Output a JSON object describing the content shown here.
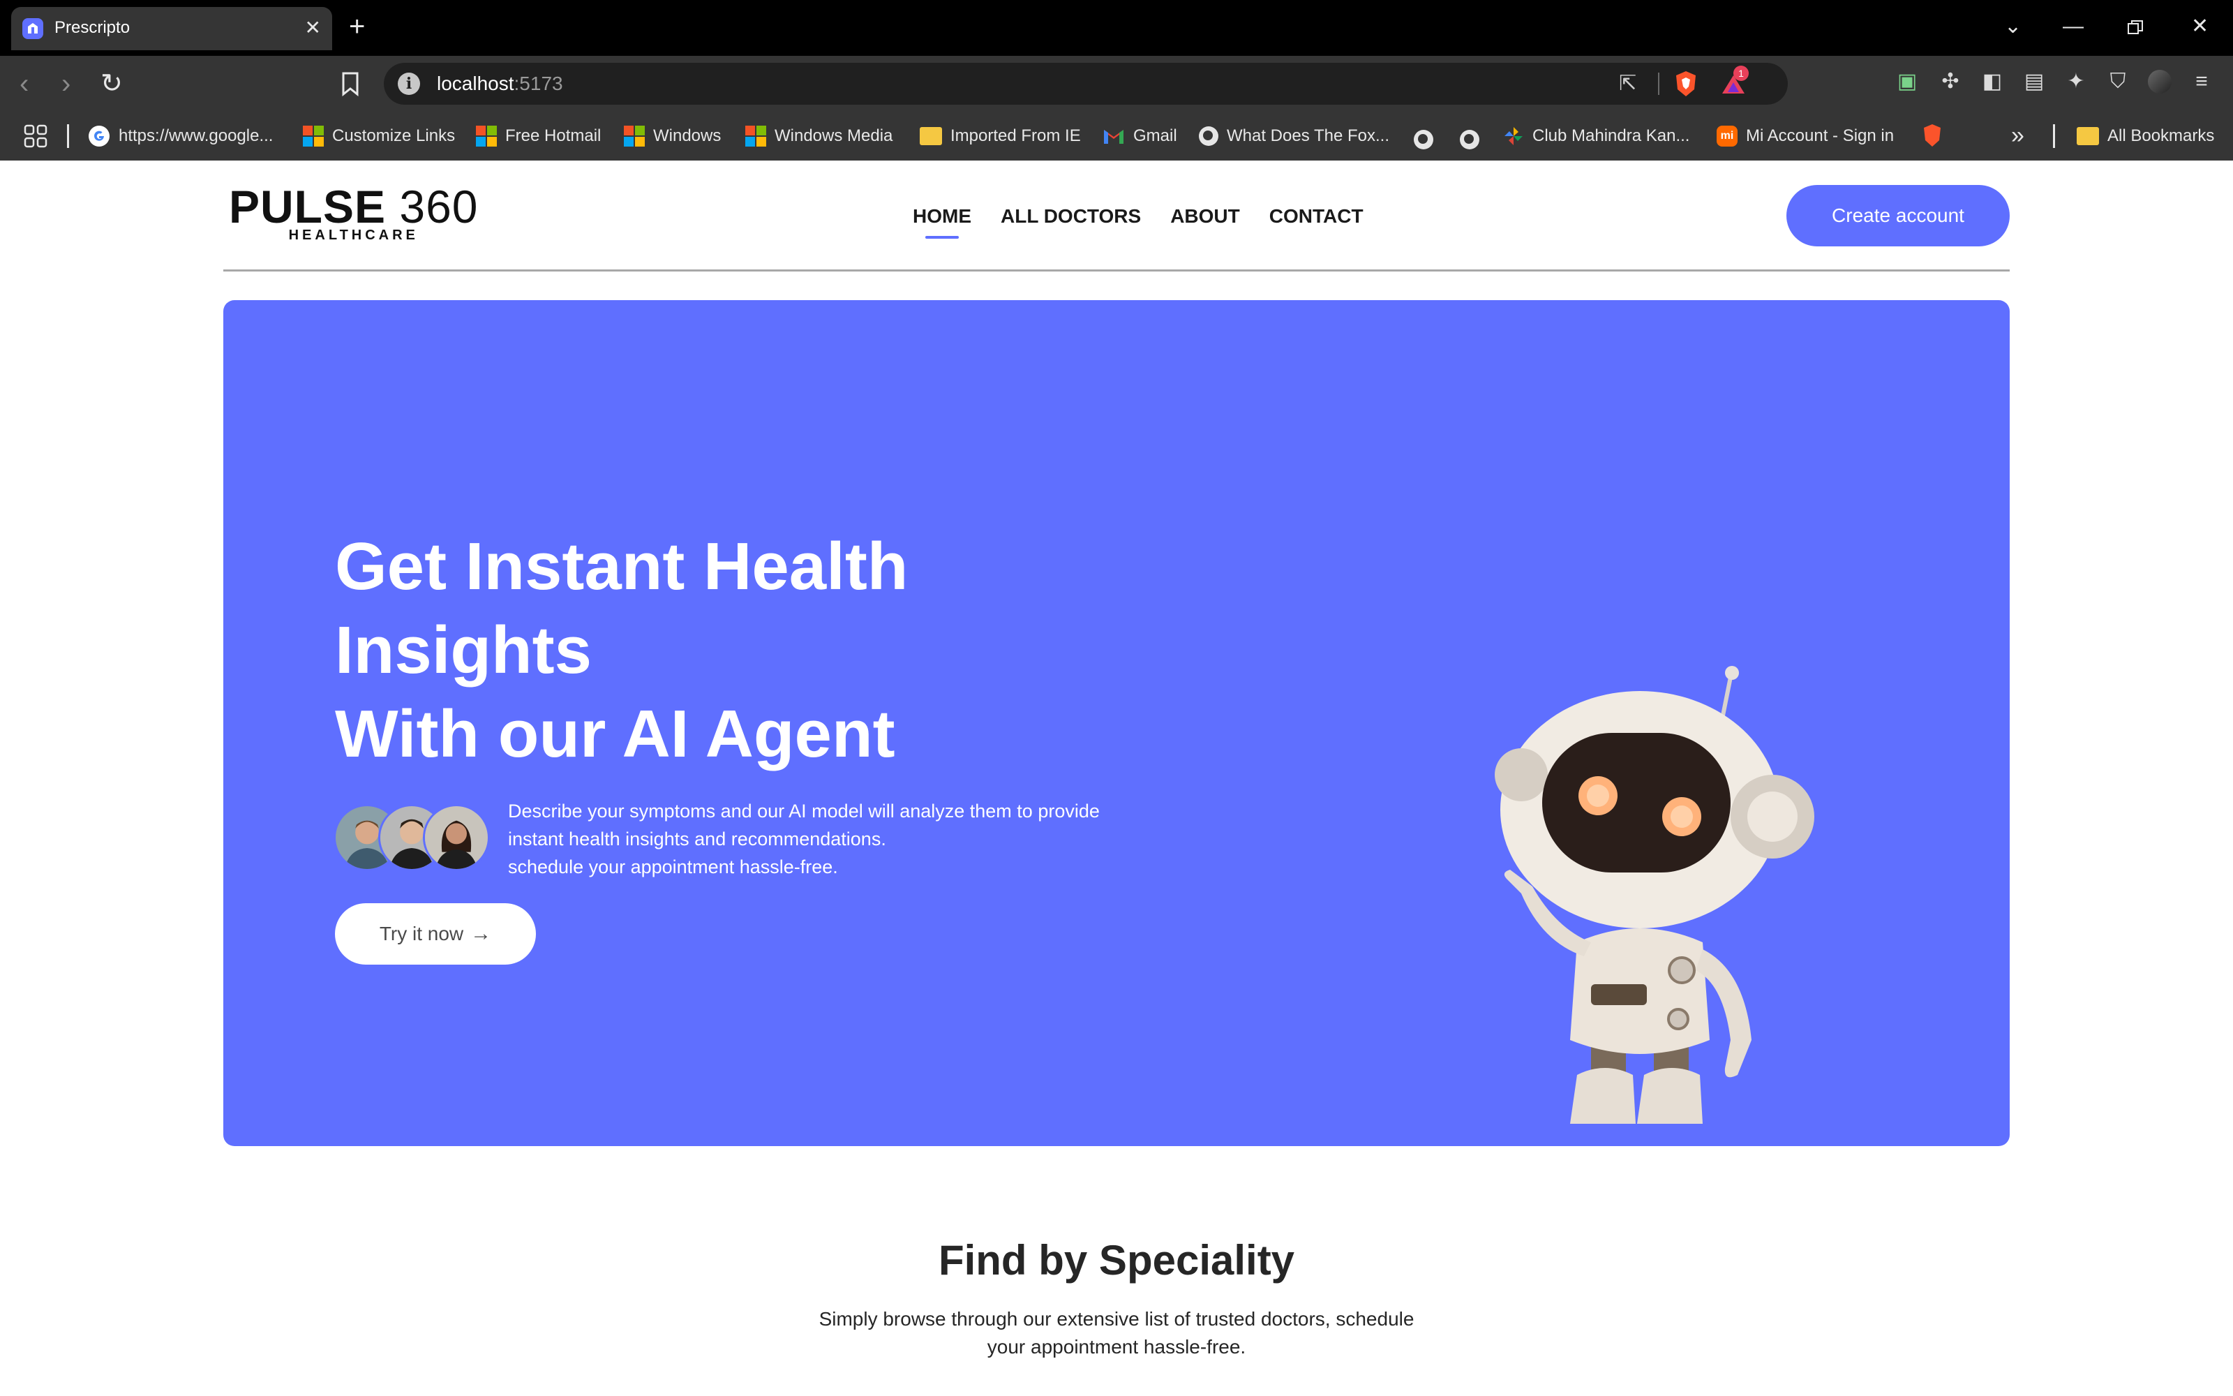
{
  "browser": {
    "tab_title": "Prescripto",
    "url_host": "localhost",
    "url_port": ":5173",
    "shield_badge": "1",
    "bookmarks": [
      {
        "label": "https://www.google...",
        "icon": "google-icon"
      },
      {
        "label": "Customize Links",
        "icon": "windows-icon"
      },
      {
        "label": "Free Hotmail",
        "icon": "windows-icon"
      },
      {
        "label": "Windows",
        "icon": "windows-icon"
      },
      {
        "label": "Windows Media",
        "icon": "windows-icon"
      },
      {
        "label": "Imported From IE",
        "icon": "folder-icon"
      },
      {
        "label": "Gmail",
        "icon": "gmail-icon"
      },
      {
        "label": "What Does The Fox...",
        "icon": "globe-icon"
      },
      {
        "label": "Club Mahindra Kan...",
        "icon": "pinwheel-icon"
      },
      {
        "label": "Mi Account - Sign in",
        "icon": "mi-icon"
      }
    ],
    "all_bookmarks_label": "All Bookmarks"
  },
  "header": {
    "logo_main": "PULSE",
    "logo_number": "360",
    "logo_sub": "HEALTHCARE",
    "nav": [
      "HOME",
      "ALL DOCTORS",
      "ABOUT",
      "CONTACT"
    ],
    "active_nav": "HOME",
    "create_account": "Create account"
  },
  "hero": {
    "title_lines": [
      "Get Instant Health",
      "Insights",
      "With our AI Agent"
    ],
    "description_lines": [
      "Describe your symptoms and our AI model will analyze them to provide",
      "instant health insights and recommendations.",
      "schedule your appointment hassle-free."
    ],
    "cta": "Try it now"
  },
  "speciality": {
    "title": "Find by Speciality",
    "desc_lines": [
      "Simply browse through our extensive list of trusted doctors, schedule",
      "your appointment hassle-free."
    ]
  },
  "colors": {
    "primary": "#5f6fff",
    "chrome_dark": "#000000",
    "chrome_toolbar": "#353535"
  }
}
